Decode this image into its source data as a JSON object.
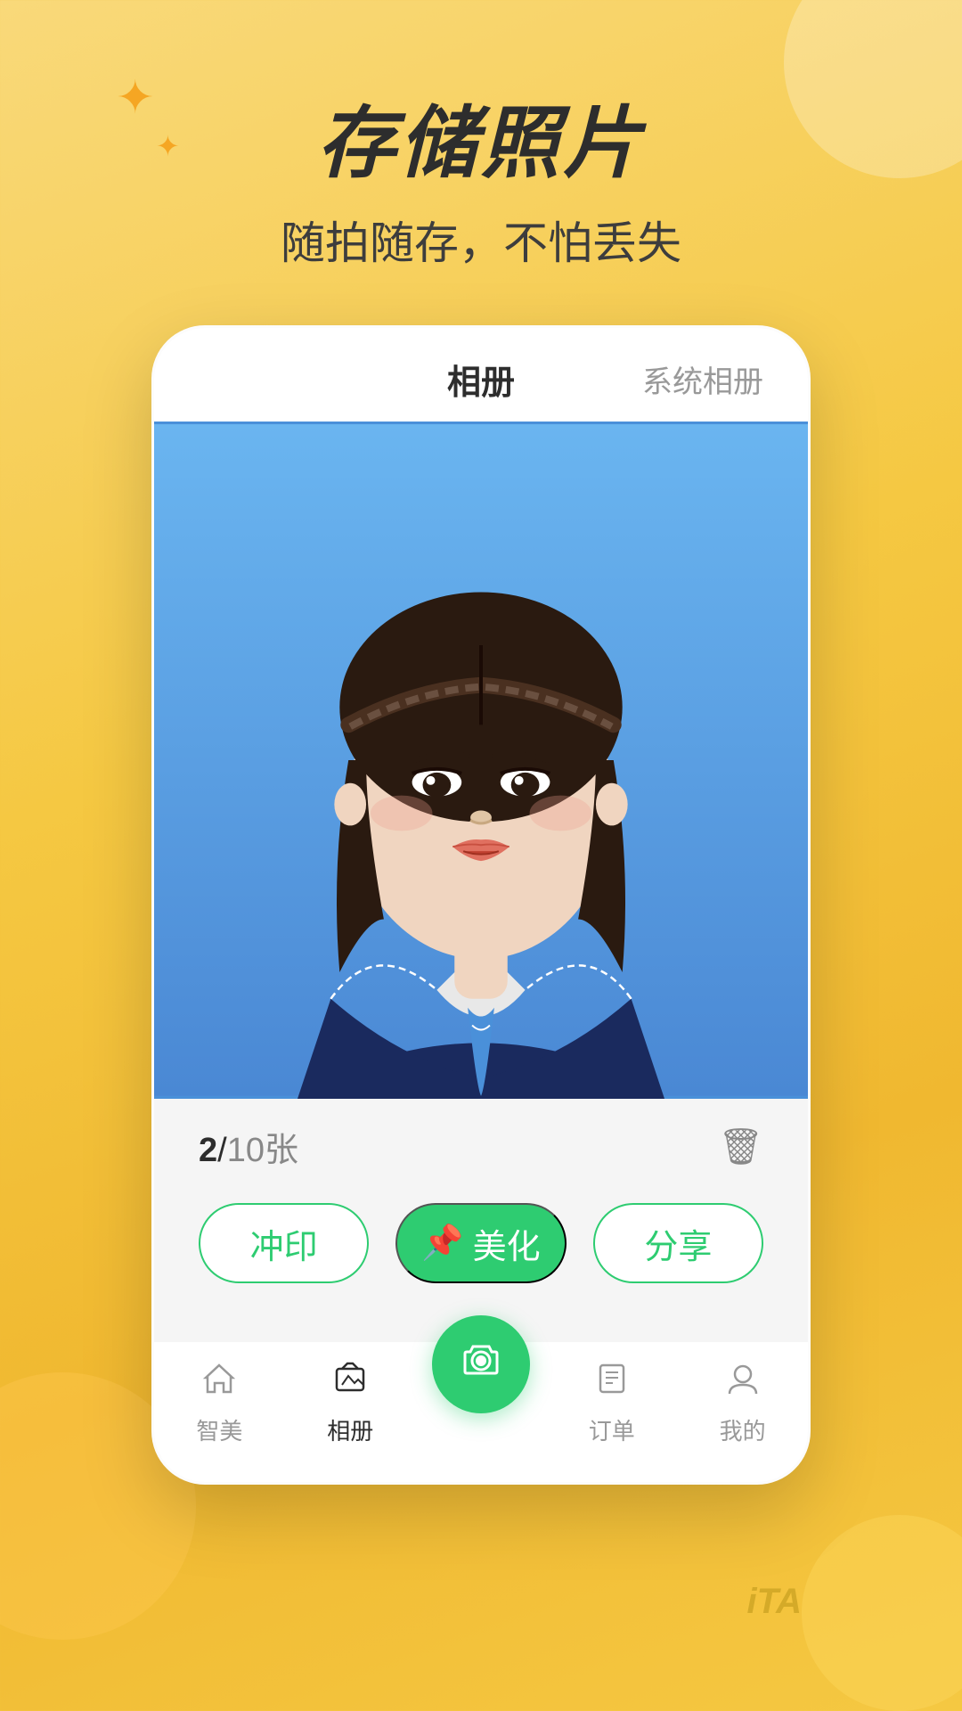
{
  "background": {
    "color_start": "#f9d97a",
    "color_end": "#f0b830"
  },
  "header": {
    "main_title": "存储照片",
    "sub_title": "随拍随存，不怕丢失"
  },
  "phone": {
    "tab_active": "相册",
    "tab_inactive": "系统相册",
    "photo_count": "2",
    "photo_total": "10张",
    "photo_count_separator": "/",
    "buttons": {
      "print": "冲印",
      "beautify": "美化",
      "share": "分享",
      "beautify_icon": "📌"
    }
  },
  "bottom_nav": {
    "items": [
      {
        "label": "智美",
        "icon": "⌂",
        "active": false
      },
      {
        "label": "相册",
        "icon": "▲",
        "active": true
      },
      {
        "label": "camera_fab",
        "icon": "📷",
        "active": false
      },
      {
        "label": "订单",
        "icon": "☰",
        "active": false
      },
      {
        "label": "我的",
        "icon": "○",
        "active": false
      }
    ]
  },
  "ita_text": "iTA"
}
